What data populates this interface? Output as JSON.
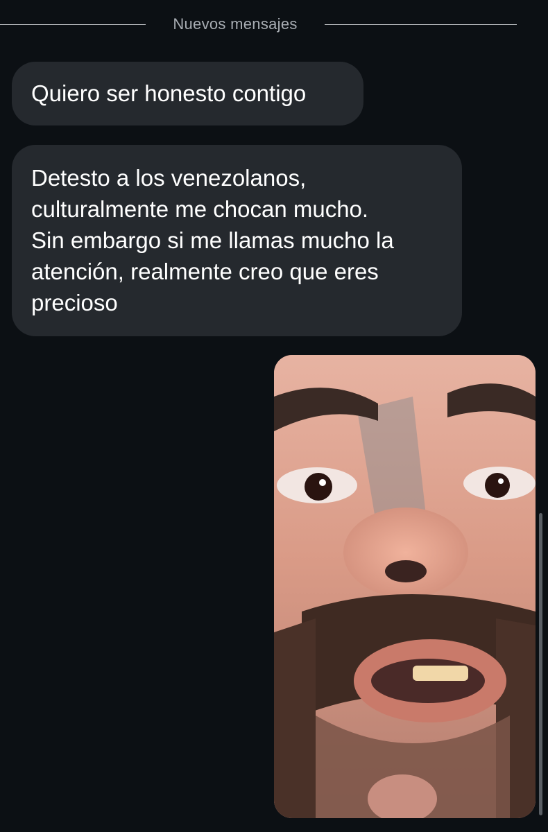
{
  "divider": {
    "label": "Nuevos mensajes"
  },
  "messages": [
    {
      "lines": [
        "Quiero ser honesto contigo"
      ]
    },
    {
      "lines": [
        "Detesto a los venezolanos,",
        "culturalmente me chocan mucho.",
        "Sin embargo si me llamas mucho la",
        "atención, realmente creo que eres",
        "precioso"
      ]
    }
  ],
  "colors": {
    "background": "#0c1014",
    "bubble": "#25292e",
    "text": "#ffffff",
    "divider_text": "#a8adb3"
  }
}
